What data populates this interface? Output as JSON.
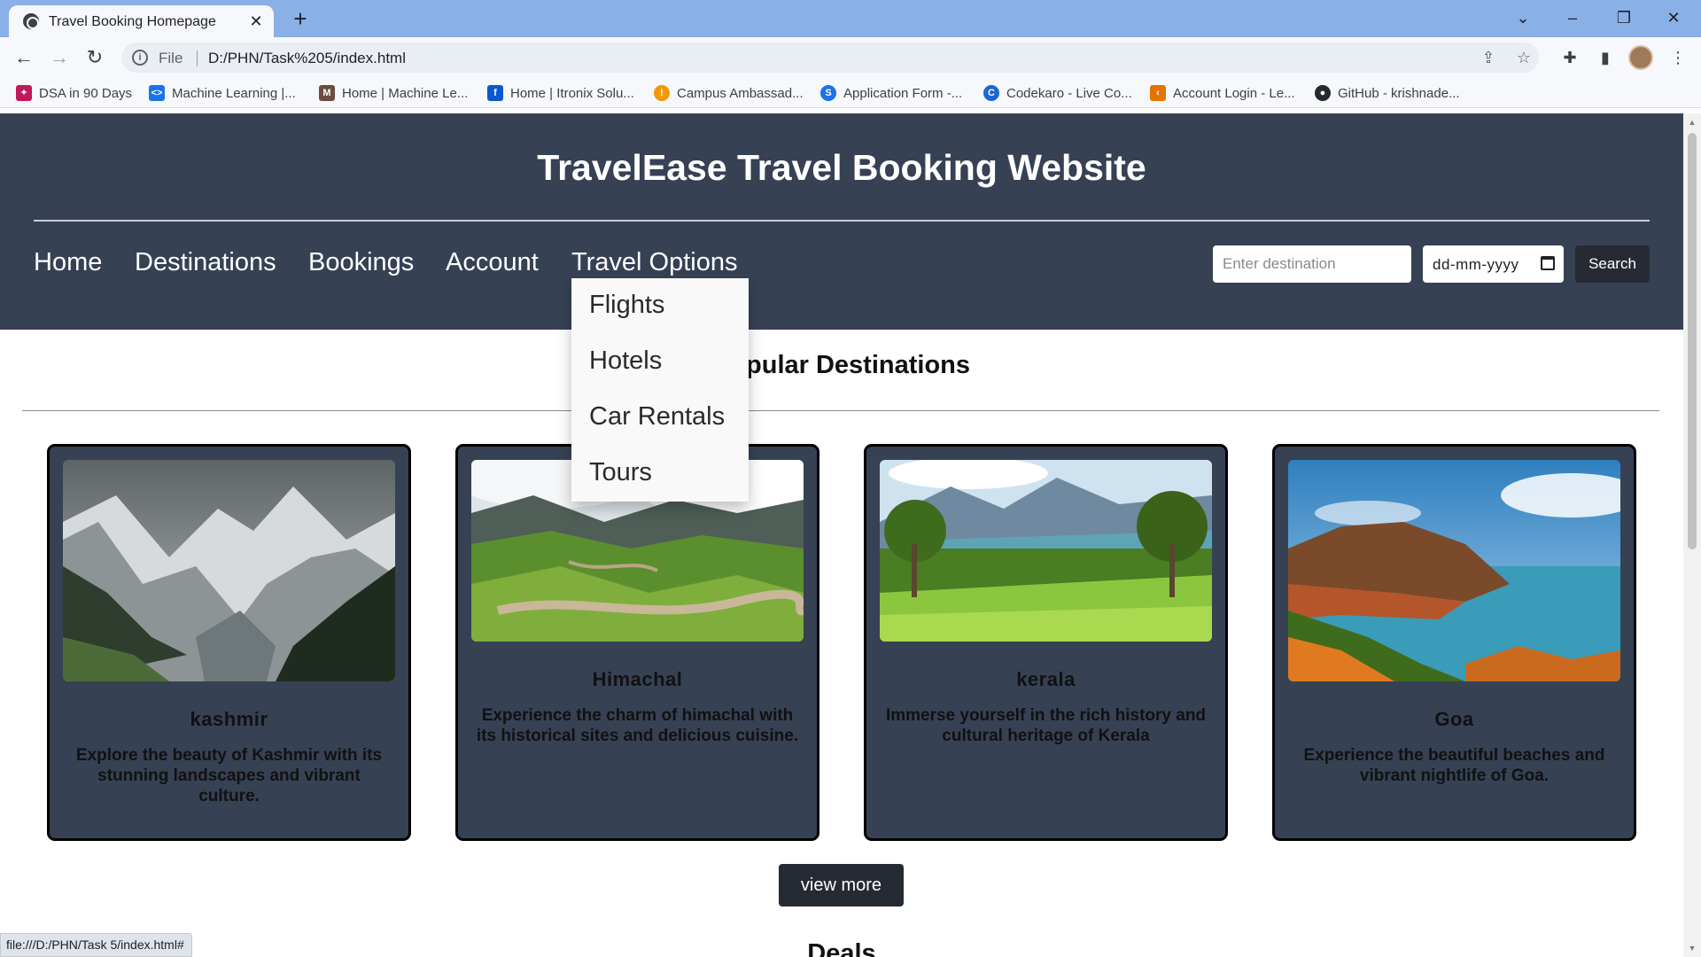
{
  "browser": {
    "tab_title": "Travel Booking Homepage",
    "url_scheme": "File",
    "url": "D:/PHN/Task%205/index.html",
    "status_url": "file:///D:/PHN/Task 5/index.html#",
    "bookmarks": [
      {
        "label": "DSA in 90 Days",
        "color": "#c2185b"
      },
      {
        "label": "Machine Learning  |...",
        "color": "#1a73e8"
      },
      {
        "label": "Home | Machine Le...",
        "color": "#6d4c41"
      },
      {
        "label": "Home | Itronix Solu...",
        "color": "#0b57d0"
      },
      {
        "label": "Campus Ambassad...",
        "color": "#f29900"
      },
      {
        "label": "Application Form -...",
        "color": "#1a73e8"
      },
      {
        "label": "Codekaro - Live Co...",
        "color": "#1967d2"
      },
      {
        "label": "Account Login - Le...",
        "color": "#e37400"
      },
      {
        "label": "GitHub - krishnade...",
        "color": "#24292f"
      }
    ]
  },
  "site": {
    "title": "TravelEase Travel Booking Website",
    "nav": [
      "Home",
      "Destinations",
      "Bookings",
      "Account",
      "Travel Options"
    ],
    "dropdown": [
      "Flights",
      "Hotels",
      "Car Rentals",
      "Tours"
    ],
    "search": {
      "placeholder": "Enter destination",
      "date_placeholder": "dd-mm-yyyy",
      "button": "Search"
    },
    "section_title": "Popular Destinations",
    "cards": [
      {
        "name": "kashmir",
        "desc": "Explore the beauty of Kashmir with its stunning landscapes and vibrant culture."
      },
      {
        "name": "Himachal",
        "desc": "Experience the charm of himachal with its historical sites and delicious cuisine."
      },
      {
        "name": "kerala",
        "desc": "Immerse yourself in the rich history and cultural heritage of Kerala"
      },
      {
        "name": "Goa",
        "desc": "Experience the beautiful beaches and vibrant nightlife of Goa."
      }
    ],
    "view_more": "view more",
    "deals_title": "Deals"
  },
  "colors": {
    "header_bg": "#364154",
    "button_bg": "#262b33",
    "tabbar_bg": "#8ab0e8"
  }
}
